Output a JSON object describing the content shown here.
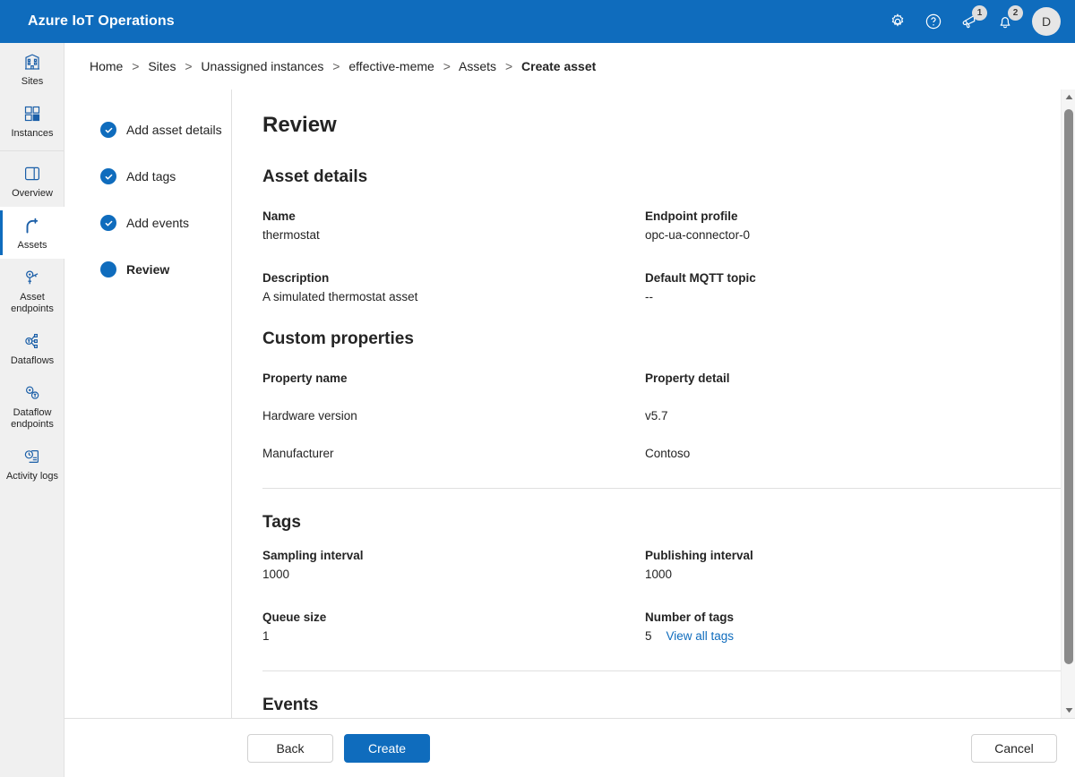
{
  "header": {
    "app_title": "Azure IoT Operations",
    "brand_color": "#0f6cbd",
    "actions": [
      {
        "name": "settings",
        "icon": "gear-icon",
        "badge": null
      },
      {
        "name": "help",
        "icon": "help-circle-icon",
        "badge": null
      },
      {
        "name": "announcements",
        "icon": "megaphone-icon",
        "badge": "1"
      },
      {
        "name": "notifications",
        "icon": "bell-icon",
        "badge": "2"
      }
    ],
    "avatar_initial": "D"
  },
  "sidebar": {
    "items": [
      {
        "label": "Sites",
        "icon": "building-icon",
        "selected": false
      },
      {
        "label": "Instances",
        "icon": "grid-squares-icon",
        "selected": false
      },
      {
        "label": "Overview",
        "icon": "panel-icon",
        "selected": false
      },
      {
        "label": "Assets",
        "icon": "robot-arm-icon",
        "selected": true
      },
      {
        "label": "Asset endpoints",
        "icon": "endpoint-key-icon",
        "selected": false
      },
      {
        "label": "Dataflows",
        "icon": "dataflow-nodes-icon",
        "selected": false
      },
      {
        "label": "Dataflow endpoints",
        "icon": "dataflow-endpoint-icon",
        "selected": false
      },
      {
        "label": "Activity logs",
        "icon": "activity-log-icon",
        "selected": false
      }
    ]
  },
  "breadcrumb": {
    "separator": ">",
    "items": [
      {
        "label": "Home",
        "current": false
      },
      {
        "label": "Sites",
        "current": false
      },
      {
        "label": "Unassigned instances",
        "current": false
      },
      {
        "label": "effective-meme",
        "current": false
      },
      {
        "label": "Assets",
        "current": false
      },
      {
        "label": "Create asset",
        "current": true
      }
    ]
  },
  "wizard": {
    "steps": [
      {
        "label": "Add asset details",
        "state": "completed"
      },
      {
        "label": "Add tags",
        "state": "completed"
      },
      {
        "label": "Add events",
        "state": "completed"
      },
      {
        "label": "Review",
        "state": "active"
      }
    ]
  },
  "main": {
    "page_title": "Review",
    "asset_details": {
      "heading": "Asset details",
      "fields": [
        {
          "label": "Name",
          "value": "thermostat"
        },
        {
          "label": "Endpoint profile",
          "value": "opc-ua-connector-0"
        },
        {
          "label": "Description",
          "value": "A simulated thermostat asset"
        },
        {
          "label": "Default MQTT topic",
          "value": "--"
        }
      ]
    },
    "custom_properties": {
      "heading": "Custom properties",
      "col_headers": [
        "Property name",
        "Property detail"
      ],
      "rows": [
        {
          "name": "Hardware version",
          "detail": "v5.7"
        },
        {
          "name": "Manufacturer",
          "detail": "Contoso"
        }
      ]
    },
    "tags": {
      "heading": "Tags",
      "fields": [
        {
          "label": "Sampling interval",
          "value": "1000"
        },
        {
          "label": "Publishing interval",
          "value": "1000"
        },
        {
          "label": "Queue size",
          "value": "1"
        },
        {
          "label": "Number of tags",
          "value": "5"
        }
      ],
      "view_all_link": "View all tags"
    },
    "events": {
      "heading": "Events"
    }
  },
  "footer": {
    "back_label": "Back",
    "create_label": "Create",
    "cancel_label": "Cancel"
  }
}
